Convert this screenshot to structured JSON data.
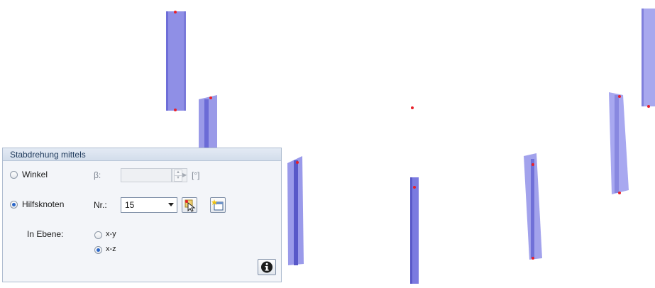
{
  "panel": {
    "title": "Stabdrehung mittels",
    "options": {
      "winkel": {
        "label": "Winkel",
        "selected": false
      },
      "hilfsknoten": {
        "label": "Hilfsknoten",
        "selected": true
      }
    },
    "beta": {
      "label": "β:",
      "value": "",
      "unit": "[°]",
      "enabled": false
    },
    "node_number": {
      "label": "Nr.:",
      "value": "15"
    },
    "in_plane": {
      "label": "In Ebene:",
      "options": [
        {
          "label": "x-y",
          "selected": false
        },
        {
          "label": "x-z",
          "selected": true
        }
      ]
    }
  },
  "colors": {
    "member_fill": "#8f8fe6",
    "member_edge": "#5a5ac8",
    "node": "#e8202a",
    "panel_bg": "#f3f5f9",
    "panel_header": "#dbe3ef"
  },
  "icons": {
    "pick_node": "cursor-pick-icon",
    "new_node": "new-node-icon",
    "info": "info-icon"
  }
}
